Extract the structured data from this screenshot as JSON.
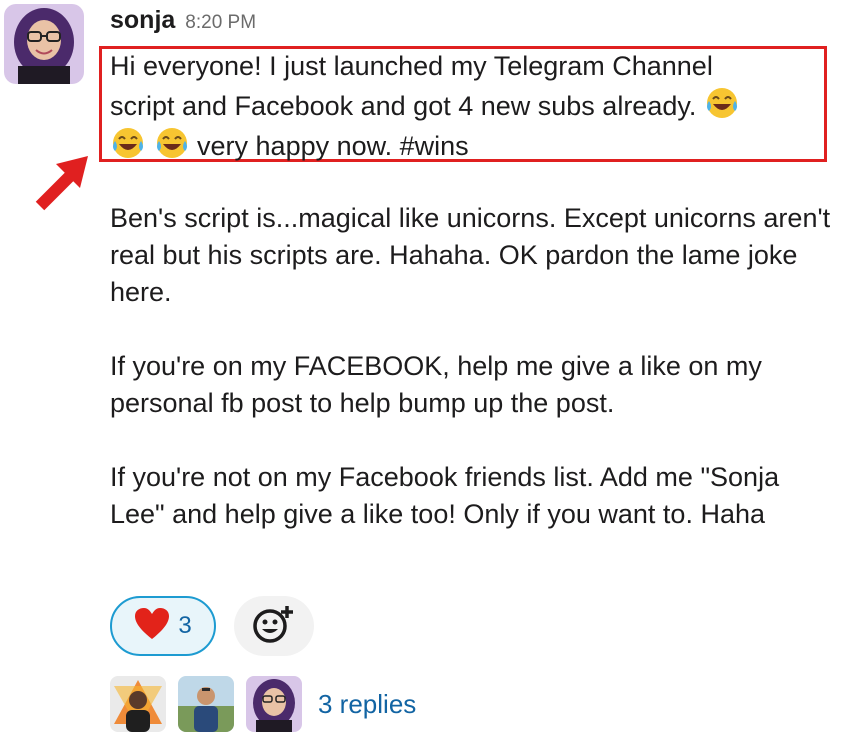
{
  "message": {
    "author": "sonja",
    "timestamp": "8:20 PM",
    "first_paragraph": {
      "line1": "Hi everyone! I just launched my Telegram Channel",
      "line2": "script and Facebook and got 4 new subs already.",
      "line3": "very happy now. #wins"
    },
    "paragraphs": [
      "Ben's script is...magical like unicorns. Except unicorns aren't real but his scripts are. Hahaha. OK pardon the lame joke here.",
      "If you're on my FACEBOOK, help me give a like on my personal fb post to help bump up the post.",
      "If you're not on my Facebook friends list. Add me \"Sonja Lee\" and help give a like too! Only if you want to. Haha"
    ],
    "emoji_name": "face-with-tears-of-joy-icon",
    "emoji_count": 3
  },
  "reactions": [
    {
      "icon": "heart-icon",
      "count": "3"
    }
  ],
  "add_reaction_icon": "add-reaction-icon",
  "thread": {
    "participant_count": 3,
    "replies_label": "3 replies"
  },
  "annotation": {
    "highlight_color": "#e02020",
    "arrow_color": "#e02020"
  }
}
